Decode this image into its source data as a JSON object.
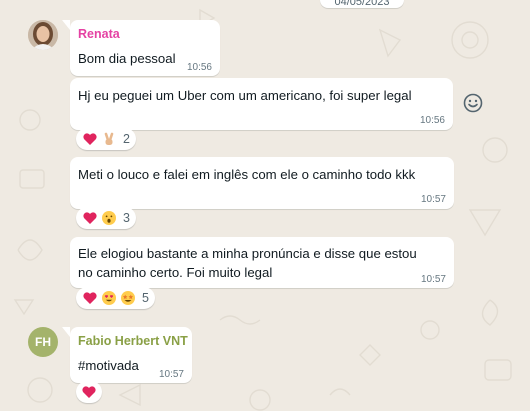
{
  "chat": {
    "date_label": "04/05/2023",
    "messages": [
      {
        "sender": "Renata",
        "sender_color": "#e542a3",
        "text": "Bom dia pessoal",
        "time": "10:56"
      },
      {
        "text": "Hj eu peguei um Uber com um americano, foi super legal",
        "time": "10:56",
        "reactions": {
          "emojis": [
            "red-heart",
            "victory-hand"
          ],
          "count": "2"
        }
      },
      {
        "text": "Meti o louco e falei em inglês com ele o caminho todo kkk",
        "time": "10:57",
        "reactions": {
          "emojis": [
            "red-heart",
            "surprised-face"
          ],
          "count": "3"
        }
      },
      {
        "text_line1": "Ele elogiou bastante a minha pronúncia e disse que estou",
        "text_line2": "no caminho certo. Foi muito legal",
        "time": "10:57",
        "reactions": {
          "emojis": [
            "red-heart",
            "heart-eyes-face",
            "star-struck-face"
          ],
          "count": "5"
        }
      },
      {
        "sender": "Fabio Herbert VNT",
        "sender_initials": "FH",
        "sender_color": "#8aa046",
        "text": "#motivada",
        "time": "10:57",
        "reactions": {
          "emojis": [
            "red-heart"
          ]
        }
      }
    ]
  },
  "icons": {
    "emoji_picker": "smiley-icon"
  },
  "colors": {
    "background": "#efeae2",
    "bubble": "#ffffff",
    "heart": "#e0245e"
  }
}
